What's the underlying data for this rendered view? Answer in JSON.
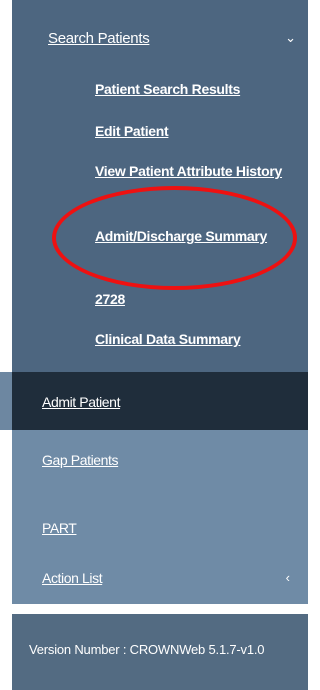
{
  "sidebar": {
    "search_patients": {
      "label": "Search Patients",
      "chevron": "chevron-down-icon",
      "chevron_glyph": "⌄",
      "subitems": [
        {
          "label": "Patient Search Results"
        },
        {
          "label": "Edit Patient"
        },
        {
          "label": "View Patient Attribute History"
        },
        {
          "label": "Admit/Discharge Summary"
        },
        {
          "label": "2728"
        },
        {
          "label": "Clinical Data Summary"
        }
      ]
    },
    "admit_patient": {
      "label": "Admit Patient"
    },
    "gap_patients": {
      "label": "Gap Patients"
    },
    "part": {
      "label": "PART"
    },
    "action_list": {
      "label": "Action List",
      "chevron": "chevron-left-icon",
      "chevron_glyph": "‹"
    }
  },
  "footer": {
    "version": "Version Number : CROWNWeb 5.1.7-v1.0"
  },
  "colors": {
    "section_bg": "#4d6680",
    "active_bg": "#1f2d3b",
    "inactive_bg": "#6f8ba6",
    "version_bg": "#536b82",
    "highlight": "#ee1111"
  }
}
